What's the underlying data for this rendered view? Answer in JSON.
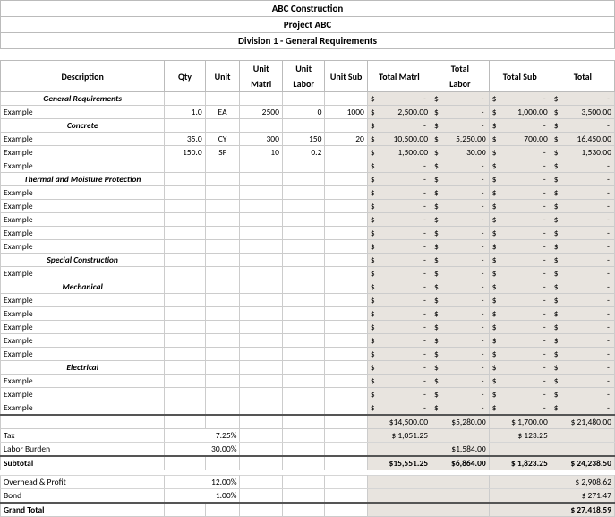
{
  "header": {
    "company": "ABC Construction",
    "project": "Project ABC",
    "division": "Division 1 - General Requirements"
  },
  "cols": {
    "desc": "Description",
    "qty": "Qty",
    "unit": "Unit",
    "umatrl_top": "Unit",
    "umatrl_bot": "Matrl",
    "ulabor_top": "Unit",
    "ulabor_bot": "Labor",
    "usub": "Unit Sub",
    "tmatrl": "Total Matrl",
    "tlabor_top": "Total",
    "tlabor_bot": "Labor",
    "tsub": "Total Sub",
    "total": "Total"
  },
  "rows": [
    {
      "t": "section",
      "desc": "General Requirements",
      "tm": "-",
      "tl": "-",
      "ts": "-",
      "tt": "-"
    },
    {
      "t": "data",
      "desc": "Example",
      "qty": "1.0",
      "unit": "EA",
      "um": "2500",
      "ul": "0",
      "us": "1000",
      "tm": "2,500.00",
      "tl": "-",
      "ts": "1,000.00",
      "tt": "3,500.00"
    },
    {
      "t": "section",
      "desc": "Concrete",
      "tm": "-",
      "tl": "-",
      "ts": "-",
      "tt": "-"
    },
    {
      "t": "data",
      "desc": "Example",
      "qty": "35.0",
      "unit": "CY",
      "um": "300",
      "ul": "150",
      "us": "20",
      "tm": "10,500.00",
      "tl": "5,250.00",
      "ts": "700.00",
      "tt": "16,450.00"
    },
    {
      "t": "data",
      "desc": "Example",
      "qty": "150.0",
      "unit": "SF",
      "um": "10",
      "ul": "0.2",
      "us": "",
      "tm": "1,500.00",
      "tl": "30.00",
      "ts": "-",
      "tt": "1,530.00"
    },
    {
      "t": "data",
      "desc": "Example",
      "tm": "-",
      "tl": "-",
      "ts": "-",
      "tt": "-"
    },
    {
      "t": "section",
      "desc": "Thermal and Moisture Protection",
      "tm": "-",
      "tl": "-",
      "ts": "-",
      "tt": "-"
    },
    {
      "t": "data",
      "desc": "Example",
      "tm": "-",
      "tl": "-",
      "ts": "-",
      "tt": "-"
    },
    {
      "t": "data",
      "desc": "Example",
      "tm": "-",
      "tl": "-",
      "ts": "-",
      "tt": "-"
    },
    {
      "t": "data",
      "desc": "Example",
      "tm": "-",
      "tl": "-",
      "ts": "-",
      "tt": "-"
    },
    {
      "t": "data",
      "desc": "Example",
      "tm": "-",
      "tl": "-",
      "ts": "-",
      "tt": "-"
    },
    {
      "t": "data",
      "desc": "Example",
      "tm": "-",
      "tl": "-",
      "ts": "-",
      "tt": "-"
    },
    {
      "t": "section",
      "desc": "Special Construction",
      "tm": "-",
      "tl": "-",
      "ts": "-",
      "tt": "-"
    },
    {
      "t": "data",
      "desc": "Example",
      "tm": "-",
      "tl": "-",
      "ts": "-",
      "tt": "-"
    },
    {
      "t": "section",
      "desc": "Mechanical",
      "tm": "-",
      "tl": "-",
      "ts": "-",
      "tt": "-"
    },
    {
      "t": "data",
      "desc": "Example",
      "tm": "-",
      "tl": "-",
      "ts": "-",
      "tt": "-"
    },
    {
      "t": "data",
      "desc": "Example",
      "tm": "-",
      "tl": "-",
      "ts": "-",
      "tt": "-"
    },
    {
      "t": "data",
      "desc": "Example",
      "tm": "-",
      "tl": "-",
      "ts": "-",
      "tt": "-"
    },
    {
      "t": "data",
      "desc": "Example",
      "tm": "-",
      "tl": "-",
      "ts": "-",
      "tt": "-"
    },
    {
      "t": "data",
      "desc": "Example",
      "tm": "-",
      "tl": "-",
      "ts": "-",
      "tt": "-"
    },
    {
      "t": "section",
      "desc": "Electrical",
      "tm": "-",
      "tl": "-",
      "ts": "-",
      "tt": "-"
    },
    {
      "t": "data",
      "desc": "Example",
      "tm": "-",
      "tl": "-",
      "ts": "-",
      "tt": "-"
    },
    {
      "t": "data",
      "desc": "Example",
      "tm": "-",
      "tl": "-",
      "ts": "-",
      "tt": "-"
    },
    {
      "t": "data",
      "desc": "Example",
      "tm": "-",
      "tl": "-",
      "ts": "-",
      "tt": "-"
    }
  ],
  "totals": {
    "line_tm": "$14,500.00",
    "line_tl": "$5,280.00",
    "line_ts": "$ 1,700.00",
    "line_tt": "$   21,480.00",
    "tax_label": "Tax",
    "tax_pct": "7.25%",
    "tax_tm": "$  1,051.25",
    "tax_ts": "$    123.25",
    "burden_label": "Labor Burden",
    "burden_pct": "30.00%",
    "burden_tl": "$1,584.00",
    "subtotal_label": "Subtotal",
    "sub_tm": "$15,551.25",
    "sub_tl": "$6,864.00",
    "sub_ts": "$ 1,823.25",
    "sub_tt": "$   24,238.50",
    "op_label": "Overhead & Profit",
    "op_pct": "12.00%",
    "op_tt": "$     2,908.62",
    "bond_label": "Bond",
    "bond_pct": "1.00%",
    "bond_tt": "$        271.47",
    "grand_label": "Grand Total",
    "grand_tt": "$   27,418.59"
  }
}
